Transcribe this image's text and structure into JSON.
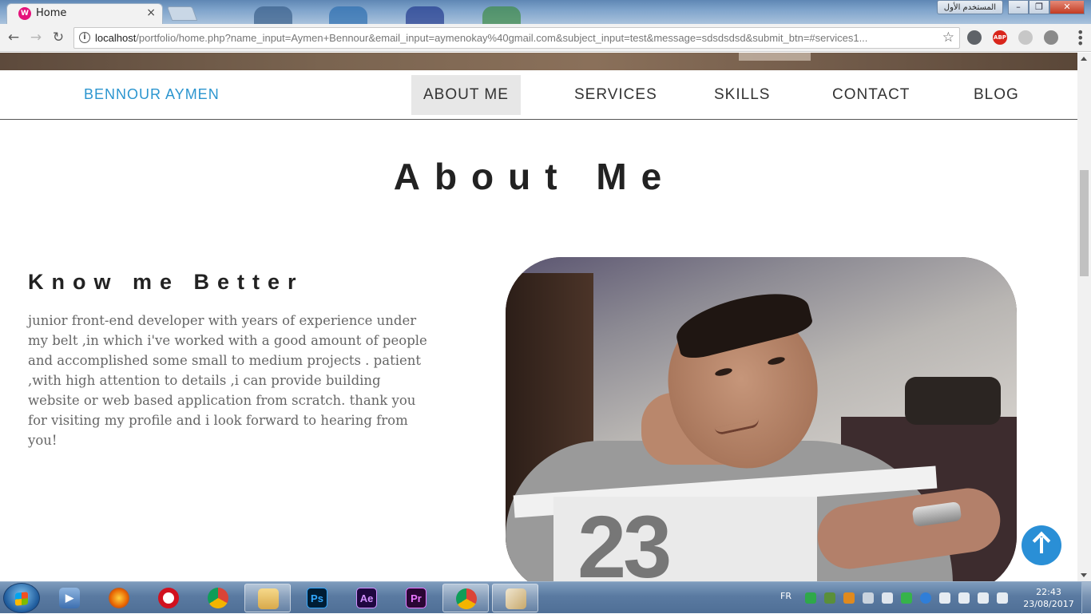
{
  "browser": {
    "tab_title": "Home",
    "tab_close": "×",
    "url_host": "localhost",
    "url_path": "/portfolio/home.php?name_input=Aymen+Bennour&email_input=aymenokay%40gmail.com&subject_input=test&message=sdsdsdsd&submit_btn=#services1...",
    "user_label": "المستخدم الأول",
    "extensions": [
      "compass-icon",
      "adblock-icon",
      "puzzle-icon",
      "shield-icon"
    ],
    "adblock_label": "ABP"
  },
  "site": {
    "brand": "BENNOUR AYMEN",
    "nav": [
      "ABOUT ME",
      "SERVICES",
      "SKILLS",
      "CONTACT",
      "BLOG"
    ],
    "active_nav": "ABOUT ME",
    "about_title": "About Me",
    "know_title": "Know me Better",
    "bio": "junior front-end developer with years of experience under my belt ,in which i've worked with a good amount of people and accomplished some small to medium projects . patient ,with high attention to details ,i can provide building website or web based application from scratch. thank you for visiting my profile and i look forward to hearing from you!",
    "photo_shirt_number": "23",
    "accent_color": "#2b95cf"
  },
  "taskbar": {
    "apps": [
      {
        "name": "media-player",
        "label": ""
      },
      {
        "name": "firefox",
        "label": ""
      },
      {
        "name": "opera",
        "label": ""
      },
      {
        "name": "chrome",
        "label": ""
      },
      {
        "name": "file-explorer",
        "label": ""
      },
      {
        "name": "photoshop",
        "label": "Ps"
      },
      {
        "name": "after-effects",
        "label": "Ae"
      },
      {
        "name": "premiere",
        "label": "Pr"
      },
      {
        "name": "chrome-active",
        "label": ""
      },
      {
        "name": "paint",
        "label": ""
      }
    ],
    "language": "FR",
    "time": "22:43",
    "date": "23/08/2017"
  }
}
